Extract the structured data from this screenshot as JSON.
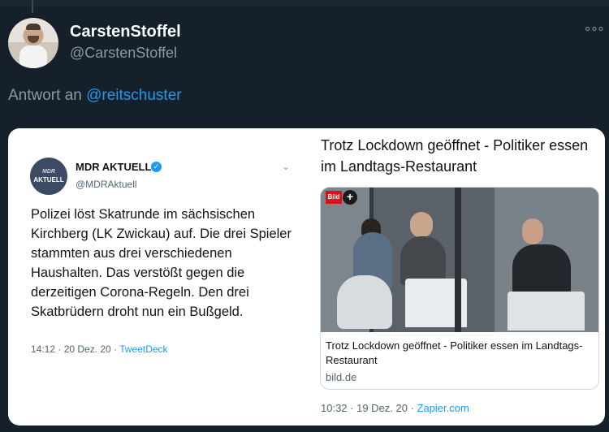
{
  "tweet": {
    "display_name": "CarstenStoffel",
    "handle": "@CarstenStoffel",
    "more_label": "°°°",
    "reply_prefix": "Antwort an ",
    "reply_mention": "@reitschuster"
  },
  "embedded": {
    "avatar_brand": "MDR",
    "avatar_label": "AKTUELL",
    "name": "MDR AKTUELL",
    "handle": "@MDRAktuell",
    "text": "Polizei löst Skatrunde im sächsischen Kirchberg (LK Zwickau) auf. Die drei Spieler stammten aus drei verschiedenen Haushalten. Das verstößt gegen die derzeitigen Corona-Regeln. Den drei Skatbrüdern droht nun ein Bußgeld.",
    "timestamp": "14:12 · 20 Dez. 20 · ",
    "source": "TweetDeck"
  },
  "right_panel": {
    "title": "Trotz Lockdown geöffnet - Politiker essen im Landtags-Restaurant",
    "bild_logo": "Bild",
    "link_text": "Trotz Lockdown geöffnet - Politiker essen im Landtags-Restaurant",
    "link_domain": "bild.de",
    "timestamp": "10:32 · 19 Dez. 20 · ",
    "source": "Zapier.com"
  },
  "colors": {
    "background": "#15202b",
    "accent": "#1d9bf0",
    "muted": "#8b98a5"
  }
}
